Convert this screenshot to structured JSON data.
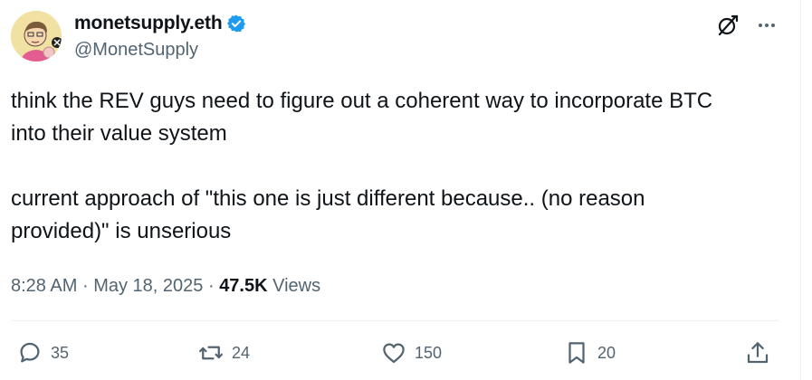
{
  "author": {
    "display_name": "monetsupply.eth",
    "handle": "@MonetSupply",
    "verified_icon": "verified-badge-icon",
    "colors": {
      "verified": "#1d9bf0"
    }
  },
  "post": {
    "text": "think the REV guys need to figure out a coherent way to incorporate BTC\ninto their value system\n\ncurrent approach of \"this one is just different because.. (no reason\nprovided)\" is unserious",
    "time": "8:28 AM",
    "sep1": "·",
    "date": "May 18, 2025",
    "sep2": "·",
    "views_count": "47.5K",
    "views_label": "Views"
  },
  "actions": {
    "replies": "35",
    "reposts": "24",
    "likes": "150",
    "bookmarks": "20"
  },
  "colors": {
    "muted": "#536471",
    "text": "#0f1419",
    "divider": "#eff3f4"
  }
}
